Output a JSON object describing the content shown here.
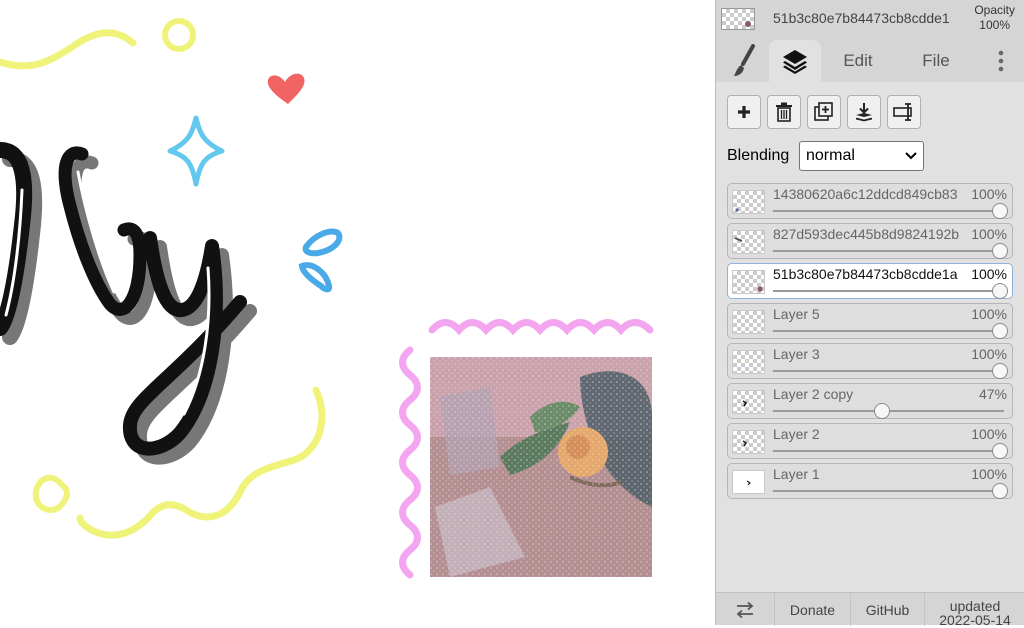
{
  "canvas": {
    "colors": {
      "lettering": "#111111",
      "shadow": "#777777",
      "yellow_doodle": "#f0f37a",
      "heart": "#f06464",
      "sparkle": "#64c8ee",
      "drops": "#4aaae8",
      "pink_wave": "#f3a6ef"
    },
    "photo_colors": {
      "base": "#b48f92",
      "glitter": "#e2c8d2",
      "flower": "#e4a86b",
      "leaves": "#5b7a5e"
    }
  },
  "panel": {
    "current_layer": {
      "name": "51b3c80e7b84473cb8cdde1",
      "opacity_label": "Opacity",
      "opacity_value": "100%"
    },
    "tabs": [
      {
        "name": "brush",
        "icon": "brush-icon"
      },
      {
        "name": "layers",
        "icon": "layers-icon",
        "active": true
      },
      {
        "label": "Edit"
      },
      {
        "label": "File"
      },
      {
        "name": "more",
        "icon": "more-vertical-icon"
      }
    ],
    "toolbar": [
      {
        "name": "add-layer",
        "icon": "plus-icon"
      },
      {
        "name": "delete-layer",
        "icon": "trash-icon"
      },
      {
        "name": "duplicate-layer",
        "icon": "duplicate-icon"
      },
      {
        "name": "merge-down",
        "icon": "merge-down-icon"
      },
      {
        "name": "rename-layer",
        "icon": "rename-icon"
      }
    ],
    "blending": {
      "label": "Blending",
      "value": "normal"
    },
    "layers": [
      {
        "name": "14380620a6c12ddcd849cb83",
        "opacity": "100%",
        "opacity_value": 100
      },
      {
        "name": "827d593dec445b8d9824192b",
        "opacity": "100%",
        "opacity_value": 100
      },
      {
        "name": "51b3c80e7b84473cb8cdde1a",
        "opacity": "100%",
        "opacity_value": 100,
        "selected": true
      },
      {
        "name": "Layer 5",
        "opacity": "100%",
        "opacity_value": 100
      },
      {
        "name": "Layer 3",
        "opacity": "100%",
        "opacity_value": 100
      },
      {
        "name": "Layer 2 copy",
        "opacity": "47%",
        "opacity_value": 47
      },
      {
        "name": "Layer 2",
        "opacity": "100%",
        "opacity_value": 100
      },
      {
        "name": "Layer 1",
        "opacity": "100%",
        "opacity_value": 100
      }
    ],
    "bottom": {
      "swap_icon": "swap-arrows-icon",
      "donate": "Donate",
      "github": "GitHub",
      "updated_label": "updated",
      "updated_date": "2022-05-14"
    }
  }
}
